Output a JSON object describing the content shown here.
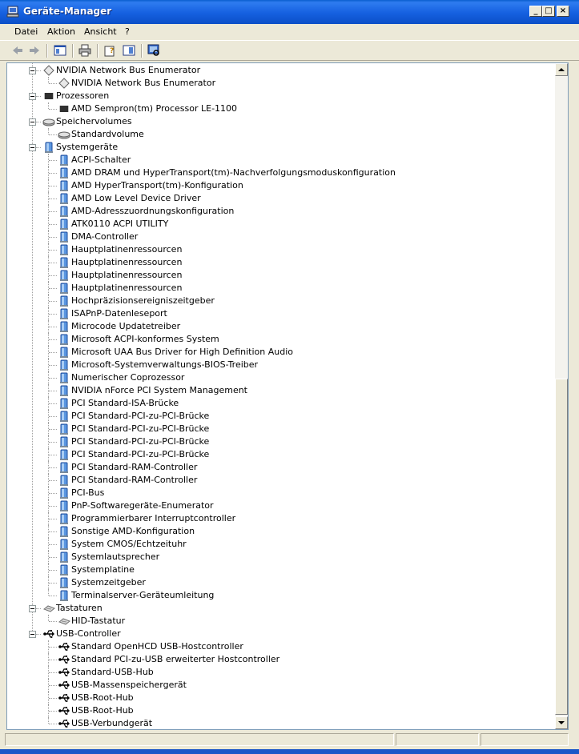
{
  "window": {
    "title": "Geräte-Manager"
  },
  "menu": [
    "Datei",
    "Aktion",
    "Ansicht",
    "?"
  ],
  "colors": {
    "titlebar": "#1560e0",
    "selection": "#316ac5",
    "device_icon": "#3a7bd5"
  },
  "tree": [
    {
      "level": 0,
      "label": "NVIDIA Network Bus Enumerator",
      "icon": "network-bus-icon",
      "expanded": true
    },
    {
      "level": 1,
      "label": "NVIDIA Network Bus Enumerator",
      "icon": "network-bus-icon"
    },
    {
      "level": 0,
      "label": "Prozessoren",
      "icon": "processor-icon",
      "expanded": true
    },
    {
      "level": 1,
      "label": "AMD Sempron(tm) Processor LE-1100",
      "icon": "processor-icon"
    },
    {
      "level": 0,
      "label": "Speichervolumes",
      "icon": "volume-icon",
      "expanded": true
    },
    {
      "level": 1,
      "label": "Standardvolume",
      "icon": "volume-icon"
    },
    {
      "level": 0,
      "label": "Systemgeräte",
      "icon": "system-device-icon",
      "expanded": true
    },
    {
      "level": 1,
      "label": "ACPI-Schalter",
      "icon": "system-device-icon"
    },
    {
      "level": 1,
      "label": "AMD DRAM und HyperTransport(tm)-Nachverfolgungsmoduskonfiguration",
      "icon": "system-device-icon"
    },
    {
      "level": 1,
      "label": "AMD HyperTransport(tm)-Konfiguration",
      "icon": "system-device-icon"
    },
    {
      "level": 1,
      "label": "AMD Low Level Device Driver",
      "icon": "system-device-icon"
    },
    {
      "level": 1,
      "label": "AMD-Adresszuordnungskonfiguration",
      "icon": "system-device-icon"
    },
    {
      "level": 1,
      "label": "ATK0110 ACPI UTILITY",
      "icon": "system-device-icon"
    },
    {
      "level": 1,
      "label": "DMA-Controller",
      "icon": "system-device-icon"
    },
    {
      "level": 1,
      "label": "Hauptplatinenressourcen",
      "icon": "system-device-icon"
    },
    {
      "level": 1,
      "label": "Hauptplatinenressourcen",
      "icon": "system-device-icon"
    },
    {
      "level": 1,
      "label": "Hauptplatinenressourcen",
      "icon": "system-device-icon"
    },
    {
      "level": 1,
      "label": "Hauptplatinenressourcen",
      "icon": "system-device-icon"
    },
    {
      "level": 1,
      "label": "Hochpräzisionsereigniszeitgeber",
      "icon": "system-device-icon"
    },
    {
      "level": 1,
      "label": "ISAPnP-Datenleseport",
      "icon": "system-device-icon"
    },
    {
      "level": 1,
      "label": "Microcode Updatetreiber",
      "icon": "system-device-icon"
    },
    {
      "level": 1,
      "label": "Microsoft ACPI-konformes System",
      "icon": "system-device-icon"
    },
    {
      "level": 1,
      "label": "Microsoft UAA Bus Driver for High Definition Audio",
      "icon": "system-device-icon"
    },
    {
      "level": 1,
      "label": "Microsoft-Systemverwaltungs-BIOS-Treiber",
      "icon": "system-device-icon"
    },
    {
      "level": 1,
      "label": "Numerischer Coprozessor",
      "icon": "system-device-icon"
    },
    {
      "level": 1,
      "label": "NVIDIA nForce PCI System Management",
      "icon": "system-device-icon"
    },
    {
      "level": 1,
      "label": "PCI Standard-ISA-Brücke",
      "icon": "system-device-icon"
    },
    {
      "level": 1,
      "label": "PCI Standard-PCI-zu-PCI-Brücke",
      "icon": "system-device-icon"
    },
    {
      "level": 1,
      "label": "PCI Standard-PCI-zu-PCI-Brücke",
      "icon": "system-device-icon"
    },
    {
      "level": 1,
      "label": "PCI Standard-PCI-zu-PCI-Brücke",
      "icon": "system-device-icon"
    },
    {
      "level": 1,
      "label": "PCI Standard-PCI-zu-PCI-Brücke",
      "icon": "system-device-icon"
    },
    {
      "level": 1,
      "label": "PCI Standard-RAM-Controller",
      "icon": "system-device-icon"
    },
    {
      "level": 1,
      "label": "PCI Standard-RAM-Controller",
      "icon": "system-device-icon"
    },
    {
      "level": 1,
      "label": "PCI-Bus",
      "icon": "system-device-icon"
    },
    {
      "level": 1,
      "label": "PnP-Softwaregeräte-Enumerator",
      "icon": "system-device-icon"
    },
    {
      "level": 1,
      "label": "Programmierbarer Interruptcontroller",
      "icon": "system-device-icon"
    },
    {
      "level": 1,
      "label": "Sonstige AMD-Konfiguration",
      "icon": "system-device-icon"
    },
    {
      "level": 1,
      "label": "System CMOS/Echtzeituhr",
      "icon": "system-device-icon"
    },
    {
      "level": 1,
      "label": "Systemlautsprecher",
      "icon": "system-device-icon"
    },
    {
      "level": 1,
      "label": "Systemplatine",
      "icon": "system-device-icon"
    },
    {
      "level": 1,
      "label": "Systemzeitgeber",
      "icon": "system-device-icon"
    },
    {
      "level": 1,
      "label": "Terminalserver-Geräteumleitung",
      "icon": "system-device-icon"
    },
    {
      "level": 0,
      "label": "Tastaturen",
      "icon": "keyboard-icon",
      "expanded": true
    },
    {
      "level": 1,
      "label": "HID-Tastatur",
      "icon": "keyboard-icon"
    },
    {
      "level": 0,
      "label": "USB-Controller",
      "icon": "usb-icon",
      "expanded": true
    },
    {
      "level": 1,
      "label": "Standard OpenHCD USB-Hostcontroller",
      "icon": "usb-icon"
    },
    {
      "level": 1,
      "label": "Standard PCI-zu-USB erweiterter Hostcontroller",
      "icon": "usb-icon"
    },
    {
      "level": 1,
      "label": "Standard-USB-Hub",
      "icon": "usb-icon"
    },
    {
      "level": 1,
      "label": "USB-Massenspeichergerät",
      "icon": "usb-icon"
    },
    {
      "level": 1,
      "label": "USB-Root-Hub",
      "icon": "usb-icon"
    },
    {
      "level": 1,
      "label": "USB-Root-Hub",
      "icon": "usb-icon"
    },
    {
      "level": 1,
      "label": "USB-Verbundgerät",
      "icon": "usb-icon"
    }
  ]
}
